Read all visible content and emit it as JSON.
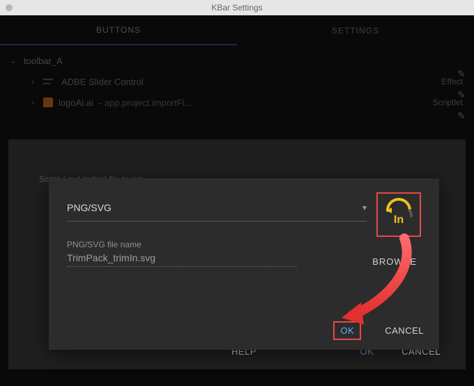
{
  "window": {
    "title": "KBar Settings"
  },
  "tabs": {
    "buttons": "BUTTONS",
    "settings": "SETTINGS"
  },
  "toolbar": {
    "name": "toolbar_A",
    "items": [
      {
        "label": "ADBE Slider Control",
        "secondary": "",
        "badge": "Effect"
      },
      {
        "label": "logoAi.ai",
        "secondary": "- app.project.importFi...",
        "badge": "Scriptlet"
      }
    ]
  },
  "panel": {
    "hint": "Script (.jsx|.jsxbin) file to run",
    "footer": {
      "help": "HELP",
      "ok": "OK",
      "cancel": "CANCEL"
    }
  },
  "dialog": {
    "select_label": "PNG/SVG",
    "file_field_label": "PNG/SVG file name",
    "file_field_value": "TrimPack_trimIn.svg",
    "browse": "BROWSE",
    "ok": "OK",
    "cancel": "CANCEL",
    "preview_text": "In"
  },
  "colors": {
    "annotation_red": "#e84848",
    "accent_blue": "#6aa8ff",
    "preview_yellow": "#f2c21a"
  }
}
